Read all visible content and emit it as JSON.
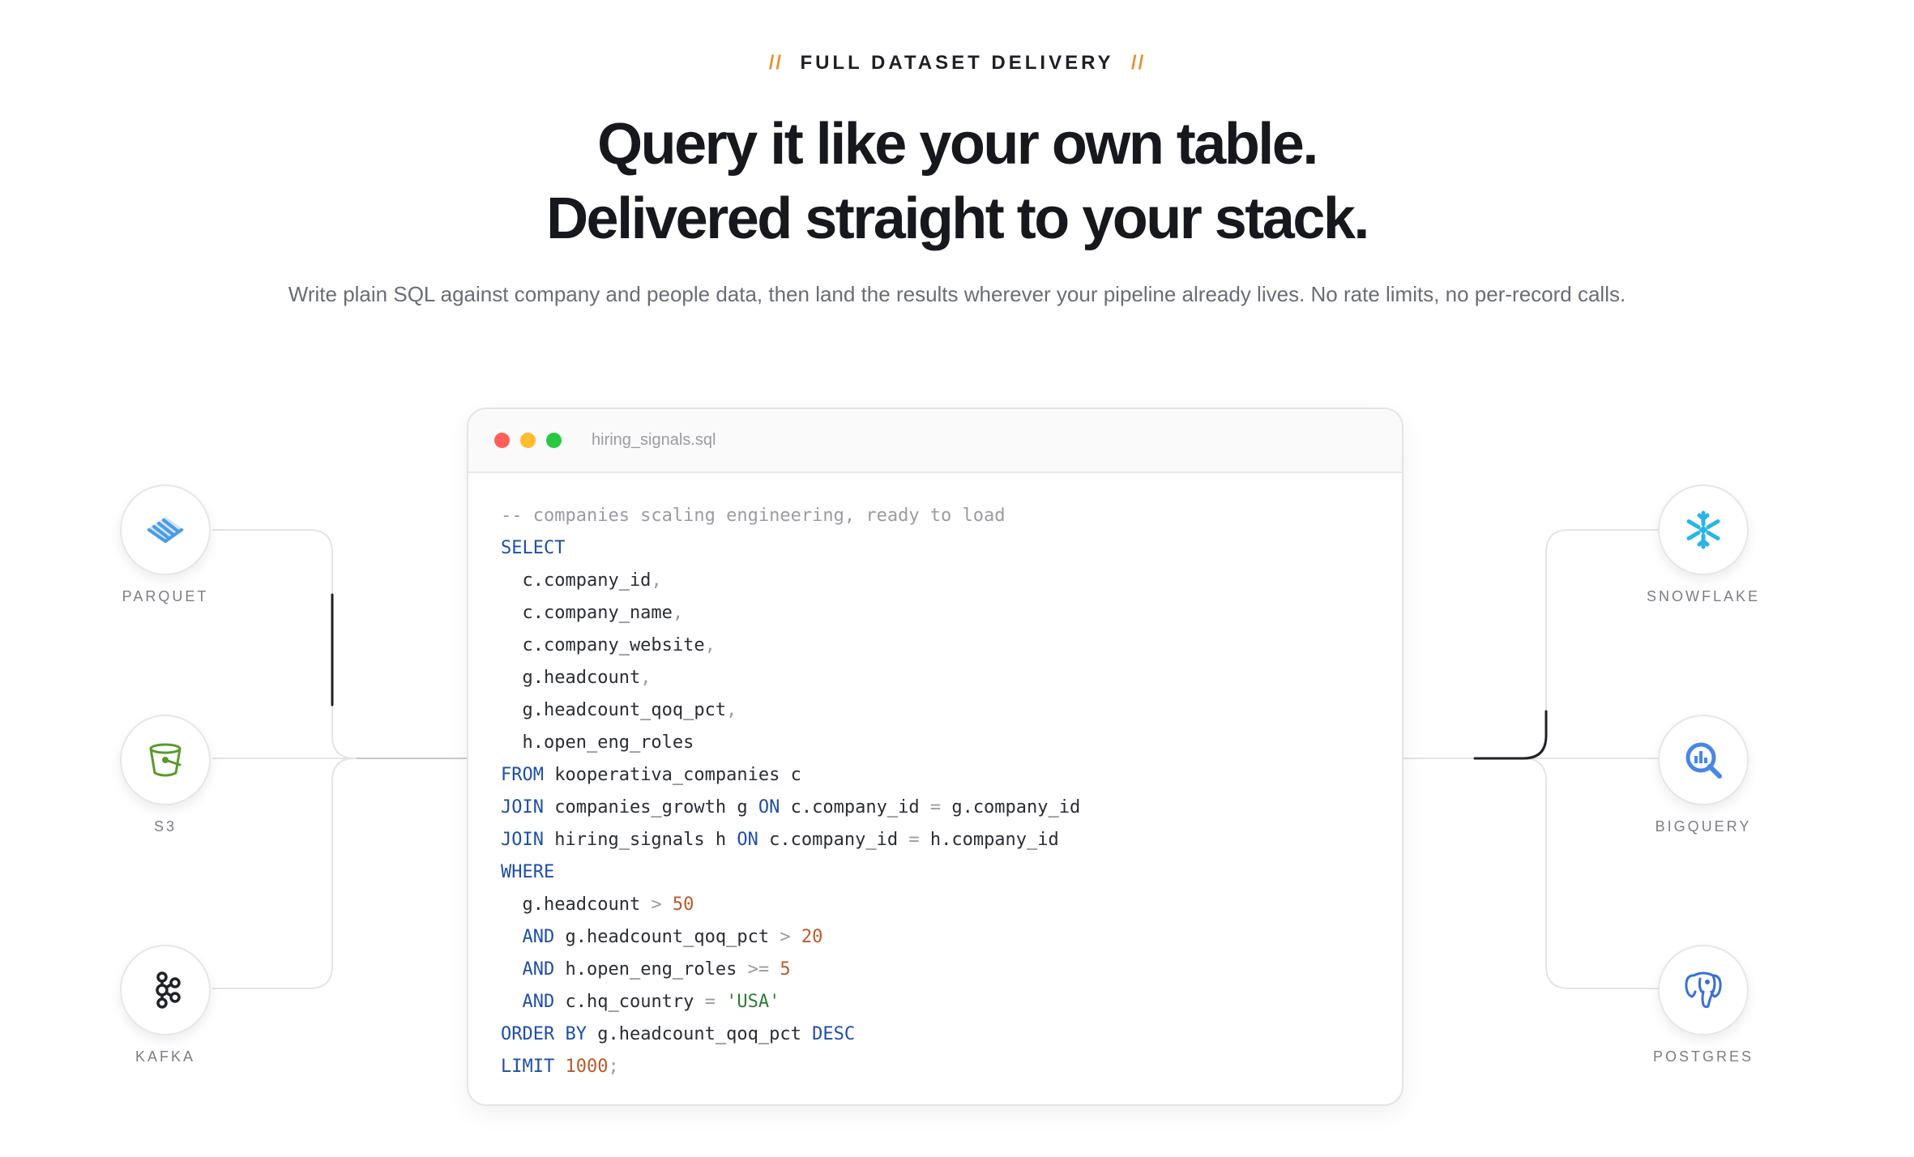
{
  "eyebrow": {
    "slash_left": "//",
    "text": "FULL DATASET DELIVERY",
    "slash_right": "//"
  },
  "headline": {
    "line1": "Query it like your own table.",
    "line2": "Delivered straight to your stack."
  },
  "subhead": "Write plain SQL against company and people data, then land the results wherever your pipeline already lives. No rate limits, no per-record calls.",
  "sources": [
    {
      "label": "PARQUET",
      "icon": "parquet-icon"
    },
    {
      "label": "S3",
      "icon": "s3-bucket-icon"
    },
    {
      "label": "KAFKA",
      "icon": "kafka-icon"
    }
  ],
  "destinations": [
    {
      "label": "SNOWFLAKE",
      "icon": "snowflake-icon"
    },
    {
      "label": "BIGQUERY",
      "icon": "bigquery-icon"
    },
    {
      "label": "POSTGRES",
      "icon": "postgres-elephant-icon"
    }
  ],
  "colors": {
    "accent": "#e8922e",
    "keyword": "#1e4fa8",
    "number": "#b85a2a",
    "string": "#2f7a3a",
    "parquet": "#4a9be8",
    "s3": "#5a9a2a",
    "snowflake": "#29b5e8",
    "bigquery": "#4a86e8",
    "postgres": "#3a6fd8"
  },
  "editor": {
    "filename": "hiring_signals.sql",
    "code": [
      [
        [
          "comment",
          "-- companies scaling engineering, ready to load"
        ]
      ],
      [
        [
          "kw",
          "SELECT"
        ]
      ],
      [
        [
          "id",
          "  c.company_id"
        ],
        [
          "punct",
          ","
        ]
      ],
      [
        [
          "id",
          "  c.company_name"
        ],
        [
          "punct",
          ","
        ]
      ],
      [
        [
          "id",
          "  c.company_website"
        ],
        [
          "punct",
          ","
        ]
      ],
      [
        [
          "id",
          "  g.headcount"
        ],
        [
          "punct",
          ","
        ]
      ],
      [
        [
          "id",
          "  g.headcount_qoq_pct"
        ],
        [
          "punct",
          ","
        ]
      ],
      [
        [
          "id",
          "  h.open_eng_roles"
        ]
      ],
      [
        [
          "kw",
          "FROM"
        ],
        [
          "id",
          " kooperativa_companies c"
        ]
      ],
      [
        [
          "kw",
          "JOIN"
        ],
        [
          "id",
          " companies_growth g "
        ],
        [
          "kw",
          "ON"
        ],
        [
          "id",
          " c.company_id "
        ],
        [
          "op",
          "="
        ],
        [
          "id",
          " g.company_id"
        ]
      ],
      [
        [
          "kw",
          "JOIN"
        ],
        [
          "id",
          " hiring_signals h "
        ],
        [
          "kw",
          "ON"
        ],
        [
          "id",
          " c.company_id "
        ],
        [
          "op",
          "="
        ],
        [
          "id",
          " h.company_id"
        ]
      ],
      [
        [
          "kw",
          "WHERE"
        ]
      ],
      [
        [
          "id",
          "  g.headcount "
        ],
        [
          "op",
          ">"
        ],
        [
          "num",
          " 50"
        ]
      ],
      [
        [
          "kw",
          "  AND"
        ],
        [
          "id",
          " g.headcount_qoq_pct "
        ],
        [
          "op",
          ">"
        ],
        [
          "num",
          " 20"
        ]
      ],
      [
        [
          "kw",
          "  AND"
        ],
        [
          "id",
          " h.open_eng_roles "
        ],
        [
          "op",
          ">="
        ],
        [
          "num",
          " 5"
        ]
      ],
      [
        [
          "kw",
          "  AND"
        ],
        [
          "id",
          " c.hq_country "
        ],
        [
          "op",
          "="
        ],
        [
          "str",
          " 'USA'"
        ]
      ],
      [
        [
          "kw",
          "ORDER BY"
        ],
        [
          "id",
          " g.headcount_qoq_pct "
        ],
        [
          "kw",
          "DESC"
        ]
      ],
      [
        [
          "kw",
          "LIMIT"
        ],
        [
          "num",
          " 1000"
        ],
        [
          "punct",
          ";"
        ]
      ]
    ]
  }
}
